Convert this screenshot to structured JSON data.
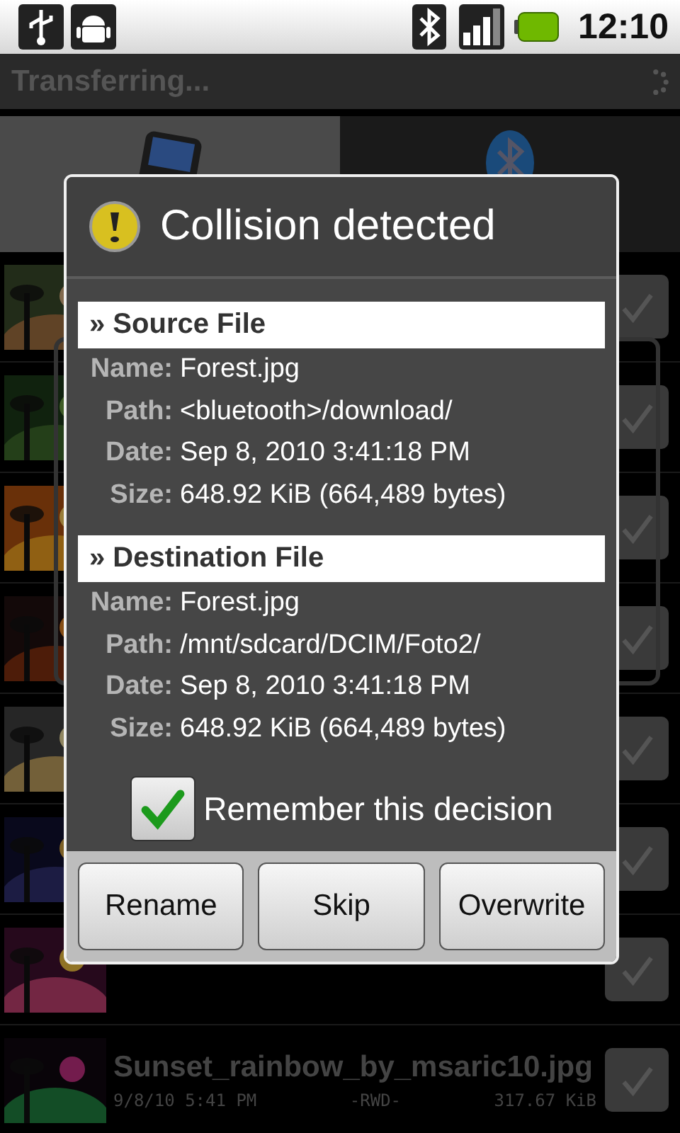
{
  "status_bar": {
    "time": "12:10"
  },
  "title": "Transferring...",
  "tabs": [
    {
      "kind": "phone",
      "selected": true
    },
    {
      "kind": "bluetooth",
      "selected": false
    }
  ],
  "files": [
    {
      "kind": "picture",
      "checked": true
    },
    {
      "kind": "picture",
      "checked": true
    },
    {
      "kind": "picture",
      "checked": true
    },
    {
      "kind": "picture",
      "checked": true
    },
    {
      "kind": "picture",
      "checked": true
    },
    {
      "kind": "picture",
      "checked": true
    },
    {
      "kind": "picture",
      "checked": true
    },
    {
      "kind": "picture",
      "name": "Sunset_rainbow_by_msaric10.jpg",
      "date": "9/8/10 5:41 PM",
      "attrs": "-RWD-",
      "size": "317.67 KiB",
      "checked": true
    }
  ],
  "dialog": {
    "title": "Collision detected",
    "sections": [
      {
        "heading": "» Source File",
        "fields": [
          {
            "label": "Name:",
            "value": "Forest.jpg"
          },
          {
            "label": "Path:",
            "value": "<bluetooth>/download/"
          },
          {
            "label": "Date:",
            "value": "Sep 8, 2010 3:41:18 PM"
          },
          {
            "label": "Size:",
            "value": "648.92 KiB (664,489 bytes)"
          }
        ]
      },
      {
        "heading": "» Destination File",
        "fields": [
          {
            "label": "Name:",
            "value": "Forest.jpg"
          },
          {
            "label": "Path:",
            "value": "/mnt/sdcard/DCIM/Foto2/"
          },
          {
            "label": "Date:",
            "value": "Sep 8, 2010 3:41:18 PM"
          },
          {
            "label": "Size:",
            "value": "648.92 KiB (664,489 bytes)"
          }
        ]
      }
    ],
    "remember": {
      "label": "Remember this decision",
      "checked": true
    },
    "buttons": [
      "Rename",
      "Skip",
      "Overwrite"
    ]
  }
}
